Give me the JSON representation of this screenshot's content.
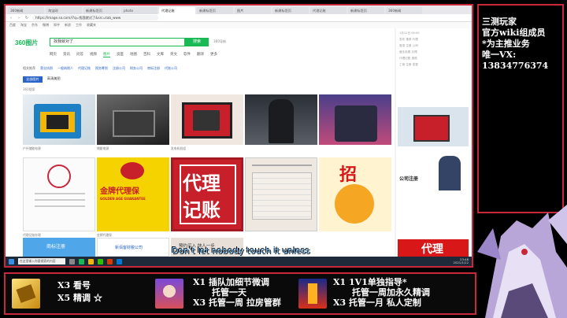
{
  "browser": {
    "tabs": [
      "360新闻",
      "淘宝网",
      "新建标签页",
      "photo",
      "代理记账",
      "新建标签页",
      "图片",
      "新建标签页",
      "代理记账",
      "新建标签页",
      "360新闻"
    ],
    "url": "https://image.so.com/i?q=找我就对了&src=tab_www",
    "bookmarks": [
      "百度",
      "淘宝",
      "京东",
      "微博",
      "知乎",
      "新浪",
      "工作",
      "收藏夹"
    ]
  },
  "search": {
    "logo": "360图片",
    "query": "找我就对了",
    "button": "搜索",
    "advanced": "360导航",
    "nav": [
      "网页",
      "资讯",
      "问答",
      "视频",
      "图片",
      "良医",
      "地图",
      "百科",
      "文库",
      "英文",
      "软件",
      "翻译",
      "更多"
    ],
    "nav_active": "图片",
    "filters": [
      "相关推荐",
      "营业执照",
      "一般纳税人",
      "代理记账",
      "税务筹划",
      "注册公司",
      "财务公司",
      "商标注册",
      "代账公司"
    ],
    "sub": [
      "全部图片",
      "高清美图"
    ],
    "count": "360搜索"
  },
  "images": {
    "row1_caps": [
      "户外储能电源",
      "储能电源",
      "发电机机组",
      "",
      ""
    ],
    "row2_caps": [
      "代理记账办理",
      "金牌代理保",
      "",
      "",
      ""
    ],
    "card_goldguarantee": "金牌代理保",
    "card_goldguarantee_en": "GOLDEN AGE GUARANTEE",
    "card_agent1": "代理",
    "card_agent2": "记账",
    "card_zhao": "招",
    "card_trademark": "商标注册",
    "card_finance": "新佰客财税公司",
    "card_company": "公司注册",
    "card_booking": "预约买入 快人一步",
    "card_red": "代理"
  },
  "side": {
    "rows": [
      "1月12日 00:00",
      "发布 推荐 代理",
      "登录 注册 公司",
      "营业执照 办理",
      "代理记账 报税",
      "工商 注册 变更"
    ]
  },
  "taskbar": {
    "search": "在这里输入你要搜索的内容",
    "time": "23:48",
    "date": "2021/1/12"
  },
  "subtitle": "Don't let nobody touch it unless",
  "info": {
    "line1": "三测玩家",
    "line2": "官方wiki组成员",
    "line3": "*为主推业务",
    "line4": "唯一VX:",
    "line5": "13834776374"
  },
  "bottom": {
    "p1a": "X3  看号",
    "p1b": "X5  精调  ☆",
    "p2a": "X1  插队加细节微调",
    "p2b": "托管一天",
    "p2c": "X3  托管一周 拉房管群",
    "p3a": "X1  1V1单独指导*",
    "p3b": "托管一周加永久精调",
    "p3c": "X3  托管一月  私人定制"
  },
  "colors": {
    "frame": "#c8283c",
    "accent": "#19b955",
    "link": "#2a64c6"
  }
}
